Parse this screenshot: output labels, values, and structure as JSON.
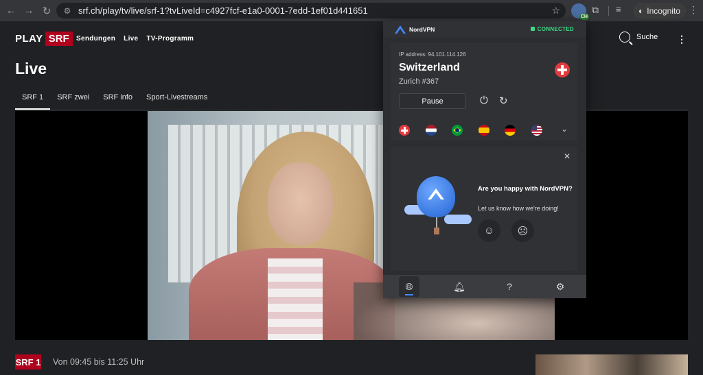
{
  "browser": {
    "url": "srf.ch/play/tv/live/srf-1?tvLiveId=c4927fcf-e1a0-0001-7edd-1ef01d441651",
    "incognito_label": "Incognito",
    "vpn_badge": "CH"
  },
  "site": {
    "logo_play": "PLAY",
    "logo_srf": "SRF",
    "nav": [
      "Sendungen",
      "Live",
      "TV-Programm"
    ],
    "search_label": "Suche",
    "page_title": "Live",
    "tabs": [
      "SRF 1",
      "SRF zwei",
      "SRF info",
      "Sport-Livestreams"
    ],
    "channel_logo": "SRF 1",
    "time_range": "Von 09:45 bis 11:25 Uhr"
  },
  "vpn": {
    "brand": "NordVPN",
    "status": "CONNECTED",
    "ip_text": "IP address: 94.101.114.126",
    "country": "Switzerland",
    "server": "Zurich #367",
    "pause_label": "Pause",
    "feedback_title": "Are you happy with NordVPN?",
    "feedback_sub": "Let us know how we're doing!",
    "status_color": "#3ddc84",
    "accent_color": "#4687ff"
  }
}
